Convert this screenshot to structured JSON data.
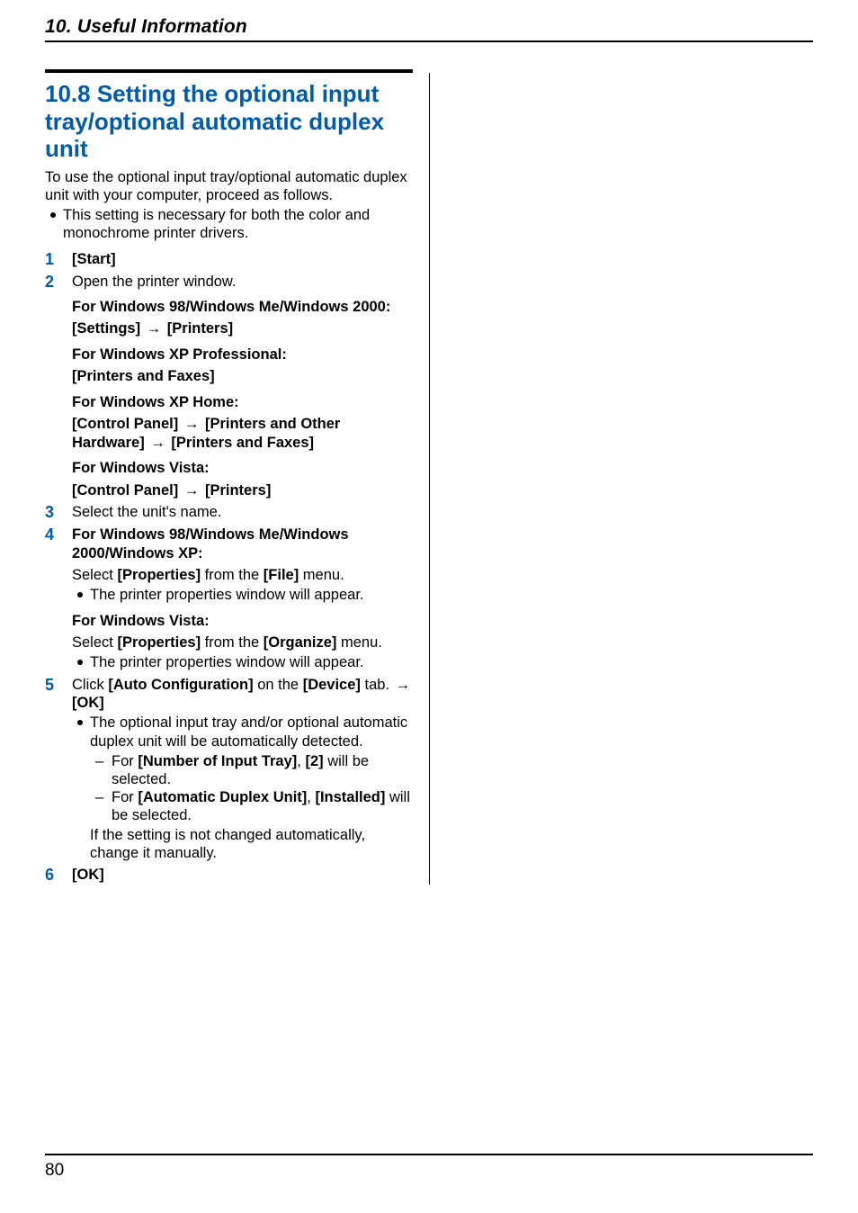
{
  "chapter": "10. Useful Information",
  "section_title": "10.8 Setting the optional input tray/optional automatic duplex unit",
  "intro": "To use the optional input tray/optional automatic duplex unit with your computer, proceed as follows.",
  "intro_bullet": "This setting is necessary for both the color and monochrome printer drivers.",
  "steps": {
    "s1": {
      "num": "1",
      "start": "Start"
    },
    "s2": {
      "num": "2",
      "open": "Open the printer window.",
      "w98_head": "For Windows 98/Windows Me/Windows 2000:",
      "w98_a": "Settings",
      "arrow": "→",
      "w98_b": "Printers",
      "xpp_head": "For Windows XP Professional:",
      "xpp_a": "Printers and Faxes",
      "xph_head": "For Windows XP Home:",
      "xph_a": "Control Panel",
      "xph_b": "Printers and Other Hardware",
      "xph_c": "Printers and Faxes",
      "vista_head": "For Windows Vista:",
      "vista_a": "Control Panel",
      "vista_b": "Printers"
    },
    "s3": {
      "num": "3",
      "text": "Select the unit's name."
    },
    "s4": {
      "num": "4",
      "head1": "For Windows 98/Windows Me/Windows 2000/Windows XP:",
      "sel1_a": "Select ",
      "props": "Properties",
      "sel1_b": " from the ",
      "file": "File",
      "sel1_c": " menu.",
      "bullet": "The printer properties window will appear.",
      "head2": "For Windows Vista:",
      "sel2_a": "Select ",
      "sel2_b": " from the ",
      "organize": "Organize",
      "sel2_c": " menu."
    },
    "s5": {
      "num": "5",
      "click_a": "Click ",
      "auto": "Auto Configuration",
      "click_b": " on the ",
      "device": "Device",
      "click_c": " tab. ",
      "ok": "OK",
      "bullet1": "The optional input tray and/or optional automatic duplex unit will be automatically detected.",
      "d1_a": "For ",
      "d1_b": "Number of Input Tray",
      "d1_c": ", ",
      "d1_d": "2",
      "d1_e": " will be selected.",
      "d2_a": "For ",
      "d2_b": "Automatic Duplex Unit",
      "d2_c": ", ",
      "d2_d": "Installed",
      "d2_e": " will be selected.",
      "note": "If the setting is not changed automatically, change it manually."
    },
    "s6": {
      "num": "6",
      "ok": "OK"
    }
  },
  "page_number": "80"
}
